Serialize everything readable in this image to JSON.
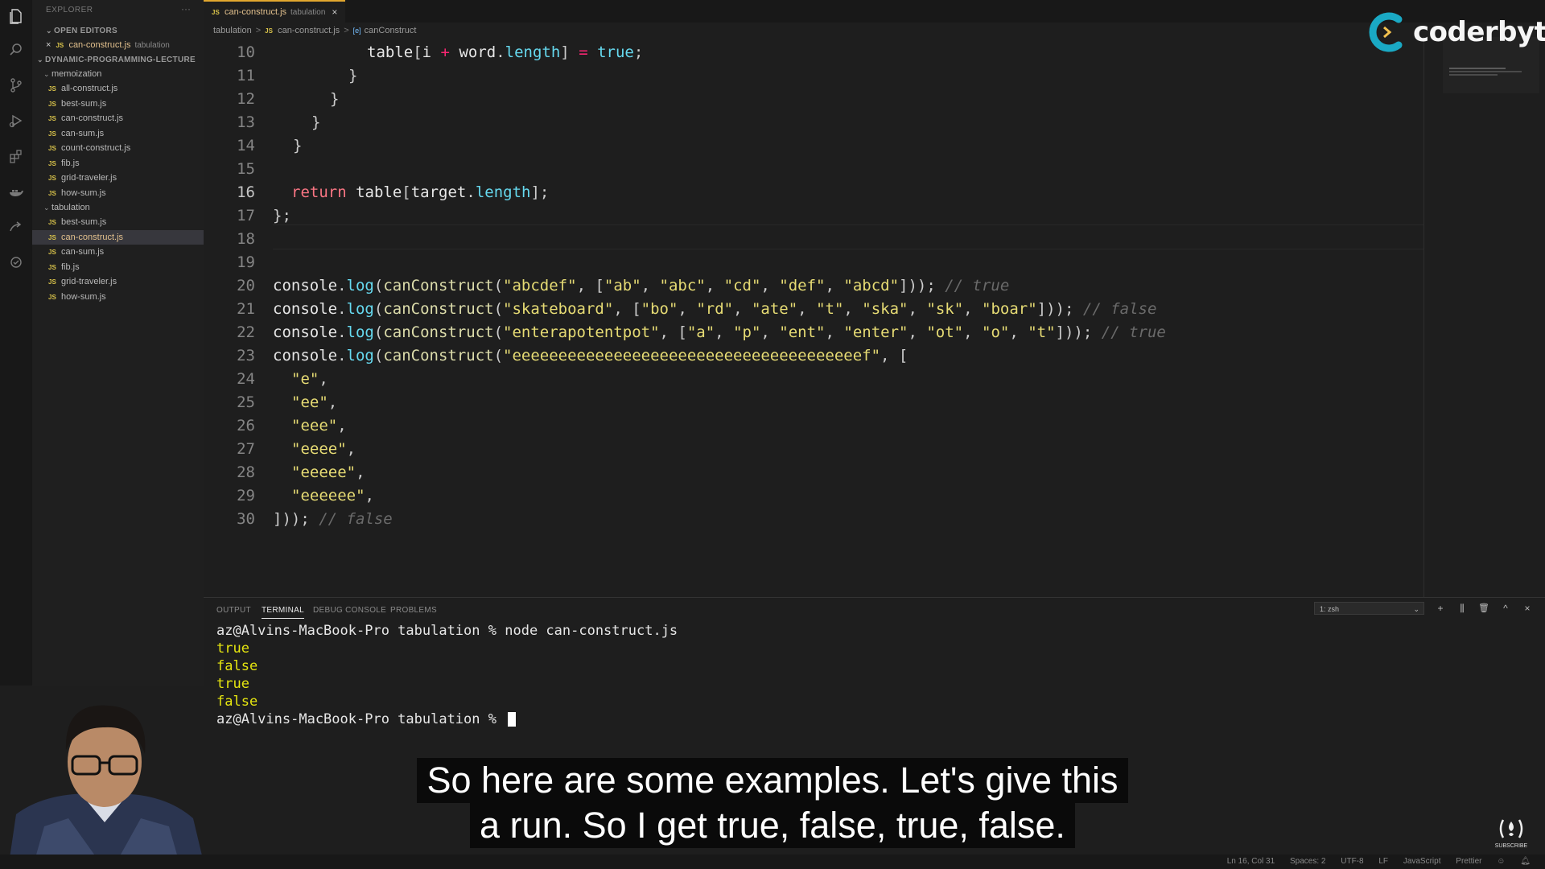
{
  "explorer": {
    "title": "EXPLORER",
    "more": "···",
    "open_editors_label": "OPEN EDITORS",
    "open_editor": {
      "close": "×",
      "name": "can-construct.js",
      "folder": "tabulation"
    },
    "root_label": "DYNAMIC-PROGRAMMING-LECTURE",
    "memoization": {
      "label": "memoization",
      "files": [
        "all-construct.js",
        "best-sum.js",
        "can-construct.js",
        "can-sum.js",
        "count-construct.js",
        "fib.js",
        "grid-traveler.js",
        "how-sum.js"
      ]
    },
    "tabulation": {
      "label": "tabulation",
      "files": [
        "best-sum.js",
        "can-construct.js",
        "can-sum.js",
        "fib.js",
        "grid-traveler.js",
        "how-sum.js"
      ]
    },
    "js_badge": "JS"
  },
  "tab": {
    "file": "can-construct.js",
    "desc": "tabulation",
    "close": "×"
  },
  "breadcrumb": {
    "folder": "tabulation",
    "file": "can-construct.js",
    "symbol": "canConstruct",
    "sep": ">"
  },
  "code": {
    "line_numbers": [
      "10",
      "11",
      "12",
      "13",
      "14",
      "15",
      "16",
      "17",
      "18",
      "19",
      "20",
      "21",
      "22",
      "23",
      "24",
      "25",
      "26",
      "27",
      "28",
      "29",
      "30"
    ],
    "lines": {
      "l10": {
        "a": "table",
        "b": "[",
        "c": "i",
        "d": " + ",
        "e": "word",
        "f": ".",
        "g": "length",
        "h": "] ",
        "i": "= ",
        "j": "true",
        "k": ";"
      },
      "l11": "}",
      "l12": "}",
      "l13": "}",
      "l14": "}",
      "l16": {
        "kw": "return",
        "a": " table",
        "b": "[",
        "c": "target",
        "d": ".",
        "e": "length",
        "f": "];"
      },
      "l17": "};",
      "l20": {
        "obj": "console",
        "dot": ".",
        "log": "log",
        "p1": "(",
        "fn": "canConstruct",
        "p2": "(",
        "s1": "\"abcdef\"",
        "c1": ", [",
        "a1": "\"ab\"",
        "a2": "\"abc\"",
        "a3": "\"cd\"",
        "a4": "\"def\"",
        "a5": "\"abcd\"",
        "end": "])); ",
        "cm": "// true"
      },
      "l21": {
        "obj": "console",
        "dot": ".",
        "log": "log",
        "p1": "(",
        "fn": "canConstruct",
        "p2": "(",
        "s1": "\"skateboard\"",
        "c1": ", [",
        "a1": "\"bo\"",
        "a2": "\"rd\"",
        "a3": "\"ate\"",
        "a4": "\"t\"",
        "a5": "\"ska\"",
        "a6": "\"sk\"",
        "a7": "\"boar\"",
        "end": "])); ",
        "cm": "// false"
      },
      "l22": {
        "obj": "console",
        "dot": ".",
        "log": "log",
        "p1": "(",
        "fn": "canConstruct",
        "p2": "(",
        "s1": "\"enterapotentpot\"",
        "c1": ", [",
        "a1": "\"a\"",
        "a2": "\"p\"",
        "a3": "\"ent\"",
        "a4": "\"enter\"",
        "a5": "\"ot\"",
        "a6": "\"o\"",
        "a7": "\"t\"",
        "end": "])); ",
        "cm": "// true"
      },
      "l23": {
        "obj": "console",
        "dot": ".",
        "log": "log",
        "p1": "(",
        "fn": "canConstruct",
        "p2": "(",
        "s1": "\"eeeeeeeeeeeeeeeeeeeeeeeeeeeeeeeeeeeeeef\"",
        "c1": ", ["
      },
      "l24": "\"e\"",
      "l25": "\"ee\"",
      "l26": "\"eee\"",
      "l27": "\"eeee\"",
      "l28": "\"eeeee\"",
      "l29": "\"eeeeee\"",
      "l30": {
        "a": "])); ",
        "cm": "// false"
      },
      "comma": ",",
      "sep": ", "
    }
  },
  "logo": {
    "text": "coderbyte",
    "colors": {
      "ring": "#1aa9c4",
      "chevron": "#f2c14e"
    }
  },
  "panel": {
    "tabs": [
      "OUTPUT",
      "TERMINAL",
      "DEBUG CONSOLE",
      "PROBLEMS"
    ],
    "terminal_select": "1: zsh",
    "actions": {
      "add": "+",
      "split": "⫼",
      "trash": "🗑",
      "maximize": "^",
      "close": "×"
    }
  },
  "terminal": {
    "prompt1": "az@Alvins-MacBook-Pro tabulation % ",
    "cmd1": "node can-construct.js",
    "outputs": [
      "true",
      "false",
      "true",
      "false"
    ],
    "prompt2": "az@Alvins-MacBook-Pro tabulation % "
  },
  "caption": {
    "line1": "So here are some examples. Let's give this",
    "line2": "a run. So I get true, false, true, false."
  },
  "status": {
    "position": "Ln 16, Col 31",
    "spaces": "Spaces: 2",
    "encoding": "UTF-8",
    "eol": "LF",
    "language": "JavaScript",
    "formatter": "Prettier"
  },
  "watermark": {
    "sub": "SUBSCRIBE"
  },
  "theme": {
    "accent": "#e2a72e",
    "string": "#e6db74",
    "keyword": "#f97583",
    "property": "#66d9ef",
    "terminal_output": "#e5e510"
  }
}
